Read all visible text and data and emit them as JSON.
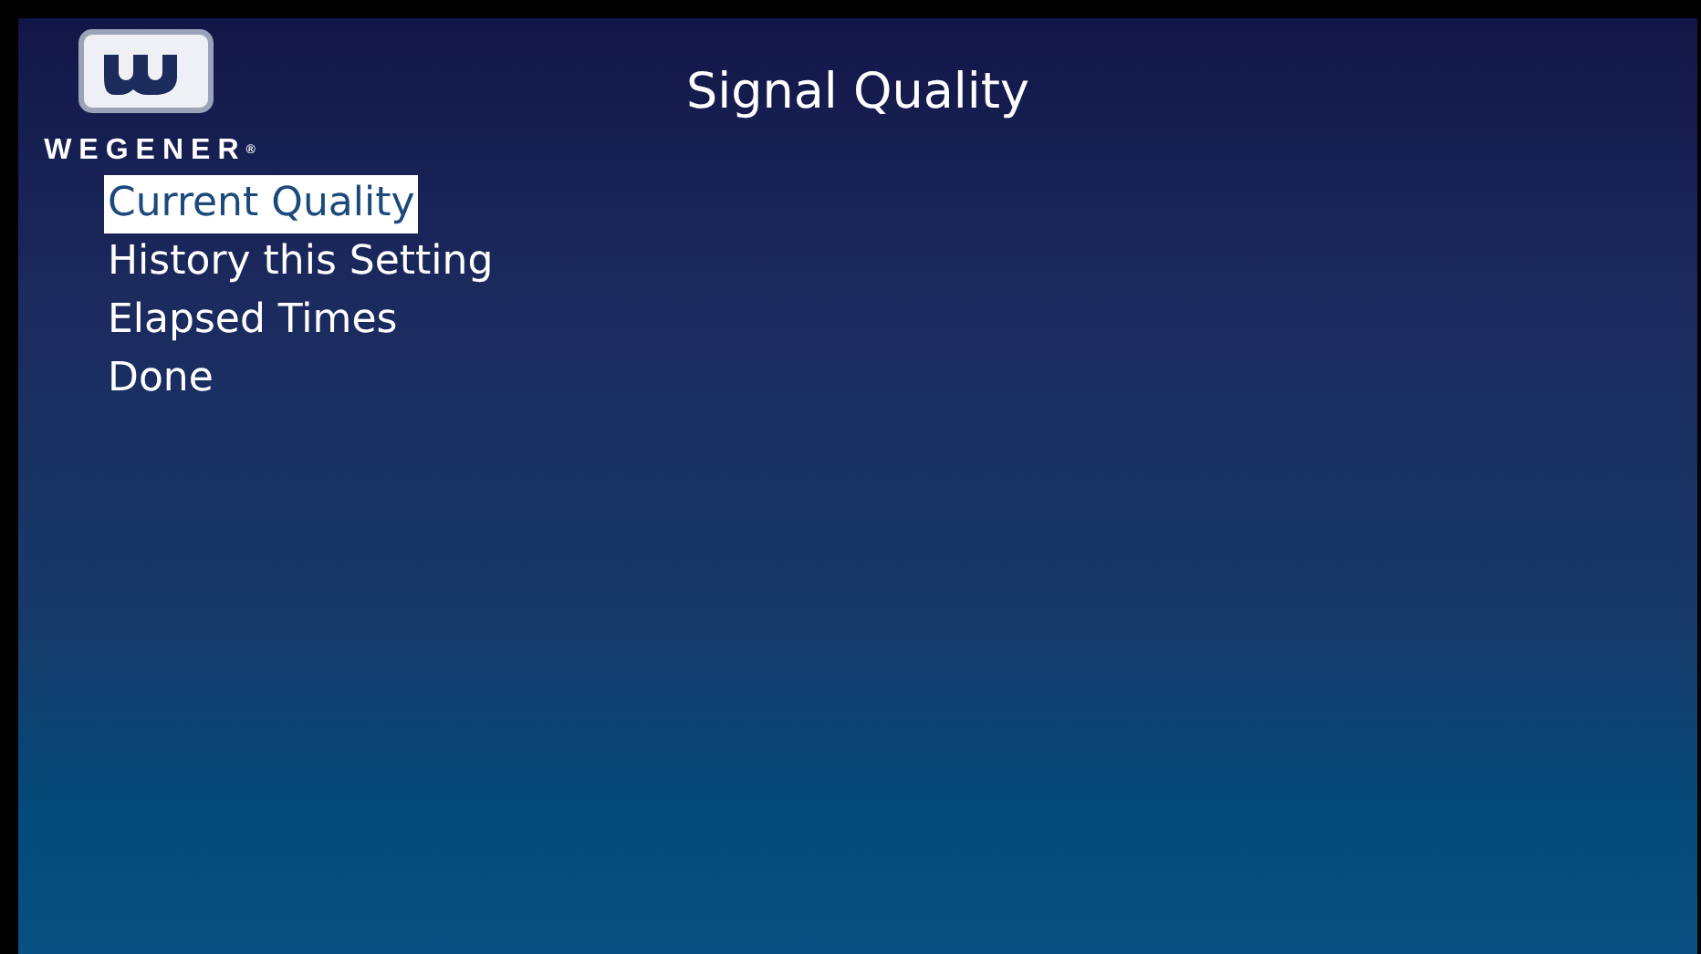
{
  "logo": {
    "wordmark": "WEGENER$^{®}$"
  },
  "title": "Signal Quality",
  "menu": [
    {
      "label": "Current Quality",
      "selected": true
    },
    {
      "label": "History this Setting",
      "selected": false
    },
    {
      "label": "Elapsed Times",
      "selected": false
    },
    {
      "label": "Done",
      "selected": false
    }
  ]
}
